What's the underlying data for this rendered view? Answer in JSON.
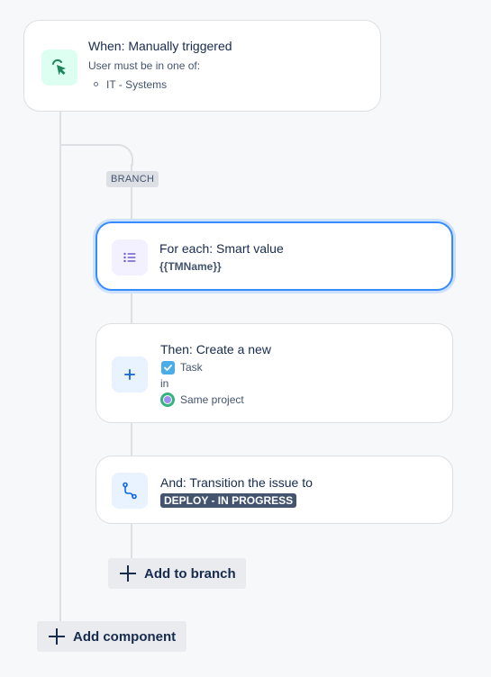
{
  "trigger": {
    "title": "When: Manually triggered",
    "subtitle": "User must be in one of:",
    "groups": [
      "IT - Systems"
    ],
    "icon": "cursor-click-icon",
    "icon_color": "#1f845a",
    "icon_bg": "#dcfff1"
  },
  "branch": {
    "tag": "BRANCH"
  },
  "foreach": {
    "title": "For each: Smart value",
    "value": "{{TMName}}",
    "icon": "list-icon",
    "icon_color": "#6e5dc6",
    "icon_bg": "#f3f0ff"
  },
  "create": {
    "title": "Then: Create a new",
    "issue_type": "Task",
    "in_label": "in",
    "project": "Same project",
    "icon": "plus-icon",
    "icon_color": "#0c66e4",
    "icon_bg": "#e9f2ff"
  },
  "transition": {
    "title": "And: Transition the issue to",
    "status": "DEPLOY - IN PROGRESS",
    "icon": "transition-icon",
    "icon_color": "#0c66e4",
    "icon_bg": "#e9f2ff"
  },
  "buttons": {
    "add_to_branch": "Add to branch",
    "add_component": "Add component"
  }
}
